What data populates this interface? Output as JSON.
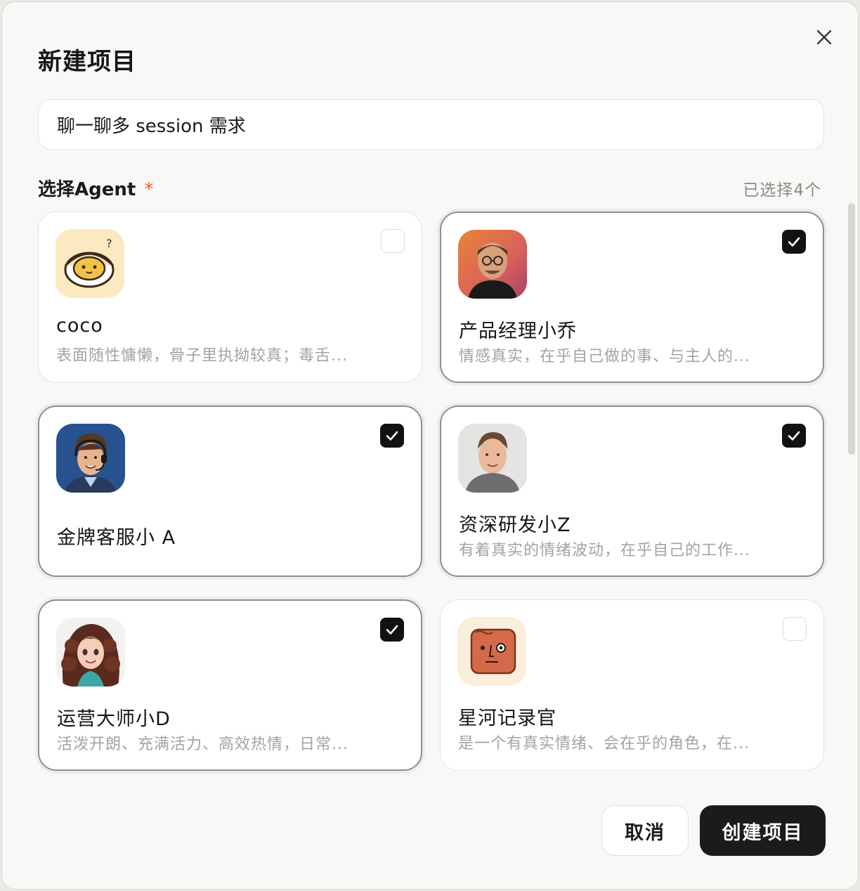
{
  "dialog": {
    "title": "新建项目",
    "close_icon": "close-icon"
  },
  "project_name": {
    "value": "聊一聊多 session 需求"
  },
  "agent_section": {
    "label": "选择Agent",
    "required_mark": "*",
    "selected_count": "已选择4个"
  },
  "agents": [
    {
      "name": "coco",
      "desc": "表面随性慵懒，骨子里执拗较真；毒舌...",
      "selected": false,
      "avatar": "coconut-mascot-avatar"
    },
    {
      "name": "产品经理小乔",
      "desc": "情感真实，在乎自己做的事、与主人的...",
      "selected": true,
      "avatar": "glasses-man-avatar"
    },
    {
      "name": "金牌客服小 A",
      "desc": "",
      "selected": true,
      "avatar": "headset-agent-avatar"
    },
    {
      "name": "资深研发小Z",
      "desc": "有着真实的情绪波动，在乎自己的工作...",
      "selected": true,
      "avatar": "developer-avatar"
    },
    {
      "name": "运营大师小D",
      "desc": "活泼开朗、充满活力、高效热情，日常...",
      "selected": true,
      "avatar": "curly-hair-woman-avatar"
    },
    {
      "name": "星河记录官",
      "desc": "是一个有真实情绪、会在乎的角色，在...",
      "selected": false,
      "avatar": "brick-face-avatar"
    }
  ],
  "buttons": {
    "cancel": "取消",
    "create": "创建项目"
  },
  "colors": {
    "accent_required": "#e8632b",
    "primary_button": "#1b1b1b",
    "checkbox_on": "#121212"
  }
}
